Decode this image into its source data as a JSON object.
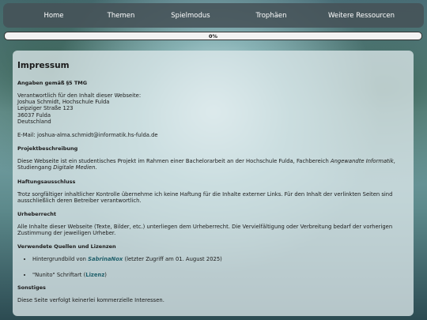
{
  "nav": {
    "items": [
      "Home",
      "Themen",
      "Spielmodus",
      "Trophäen",
      "Weitere Ressourcen"
    ]
  },
  "progress": {
    "label": "0%",
    "value": 0
  },
  "page": {
    "title": "Impressum",
    "tmg_heading": "Angaben gemäß §5 TMG",
    "responsible_intro": "Verantwortlich für den Inhalt dieser Webseite:",
    "address_lines": [
      "Joshua Schmidt, Hochschule Fulda",
      "Leipziger Straße 123",
      "36037 Fulda",
      "Deutschland"
    ],
    "email": "E-Mail: joshua-alma.schmidt@informatik.hs-fulda.de",
    "project_heading": "Projektbeschreibung",
    "project_text_1": "Diese Webseite ist ein studentisches Projekt im Rahmen einer Bachelorarbeit an der Hochschule Fulda, Fachbereich ",
    "project_em_1": "Angewandte Informatik",
    "project_text_2": ", Studiengang ",
    "project_em_2": "Digitale Medien",
    "project_text_3": ".",
    "liability_heading": "Haftungsausschluss",
    "liability_text": "Trotz sorgfältiger inhaltlicher Kontrolle übernehme ich keine Haftung für die Inhalte externer Links. Für den Inhalt der verlinkten Seiten sind ausschließlich deren Betreiber verantwortlich.",
    "copyright_heading": "Urheberrecht",
    "copyright_text": "Alle Inhalte dieser Webseite (Texte, Bilder, etc.) unterliegen dem Urheberrecht. Die Vervielfältigung oder Verbreitung bedarf der vorherigen Zustimmung der jeweiligen Urheber.",
    "sources_heading": "Verwendete Quellen und Lizenzen",
    "sources": [
      {
        "prefix": "Hintergrundbild von ",
        "link": "SabrinaNox",
        "suffix": " (letzter Zugriff am 01. August 2025)"
      },
      {
        "prefix": "\"Nunito\" Schriftart (",
        "link": "Lizenz",
        "suffix": ")"
      }
    ],
    "misc_heading": "Sonstiges",
    "misc_text": "Diese Seite verfolgt keinerlei kommerzielle Interessen."
  }
}
